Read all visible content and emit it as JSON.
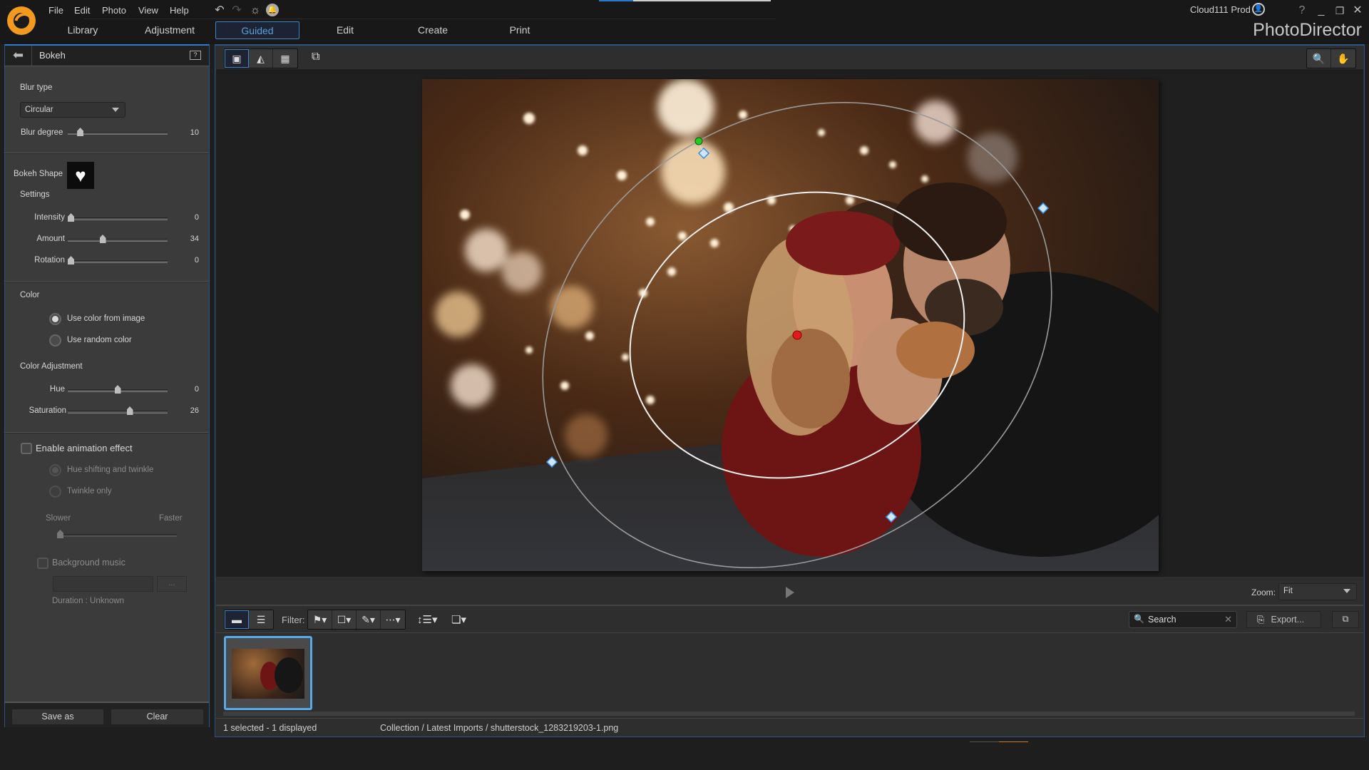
{
  "app": {
    "name": "PhotoDirector",
    "user": "Cloud111 Prod",
    "top_progress": 0.2,
    "menu": [
      "File",
      "Edit",
      "Photo",
      "View",
      "Help"
    ],
    "header_icons": [
      "undo-icon",
      "redo-icon",
      "settings-icon",
      "notification-icon"
    ],
    "window_controls": [
      "help-icon",
      "minimize-icon",
      "restore-icon",
      "close-icon"
    ],
    "nav_tabs": [
      {
        "label": "Library",
        "active": false
      },
      {
        "label": "Adjustment",
        "active": false
      },
      {
        "label": "Guided",
        "active": true
      },
      {
        "label": "Edit",
        "active": false
      },
      {
        "label": "Create",
        "active": false
      },
      {
        "label": "Print",
        "active": false
      }
    ],
    "accent_color": "#3d86c6",
    "logo_color": "#f39a1e"
  },
  "left_panel": {
    "title": "Bokeh",
    "blur_type_label": "Blur type",
    "blur_type_value": "Circular",
    "blur_degree_label": "Blur degree",
    "blur_degree_value": "10",
    "blur_degree_fraction": 0.1,
    "bokeh_shape_label": "Bokeh Shape",
    "bokeh_shape": "heart",
    "settings_label": "Settings",
    "sliders": [
      {
        "label": "Intensity",
        "value": "0",
        "fraction": 0.0
      },
      {
        "label": "Amount",
        "value": "34",
        "fraction": 0.34
      },
      {
        "label": "Rotation",
        "value": "0",
        "fraction": 0.0
      }
    ],
    "color_label": "Color",
    "color_options": [
      {
        "label": "Use color from image",
        "selected": true
      },
      {
        "label": "Use random color",
        "selected": false
      }
    ],
    "color_adjustment_label": "Color Adjustment",
    "color_sliders": [
      {
        "label": "Hue",
        "value": "0",
        "fraction": 0.5
      },
      {
        "label": "Saturation",
        "value": "26",
        "fraction": 0.63
      }
    ],
    "animation_label": "Enable animation effect",
    "animation_enabled": false,
    "animation_options": [
      {
        "label": "Hue shifting and twinkle",
        "selected": true
      },
      {
        "label": "Twinkle only",
        "selected": false
      }
    ],
    "speed_slower": "Slower",
    "speed_faster": "Faster",
    "speed_fraction": 0.0,
    "background_music_label": "Background music",
    "browse_label": "...",
    "duration_label": "Duration : Unknown",
    "save_as_label": "Save as",
    "clear_label": "Clear"
  },
  "viewer": {
    "view_modes": [
      "viewer-filmstrip-icon",
      "viewer-single-icon",
      "grid-icon"
    ],
    "compare_icon": "compare-icon",
    "zoom_tool_icon": "magnifier-icon",
    "pan_tool_icon": "hand-icon",
    "play_icon": "play-icon",
    "zoom_label": "Zoom:",
    "zoom_value": "Fit"
  },
  "filter_bar": {
    "filter_label": "Filter:",
    "search_placeholder": "Search",
    "export_label": "Export..."
  },
  "status": {
    "selection": "1 selected - 1 displayed",
    "path": "Collection / Latest Imports / shutterstock_1283219203-1.png"
  }
}
